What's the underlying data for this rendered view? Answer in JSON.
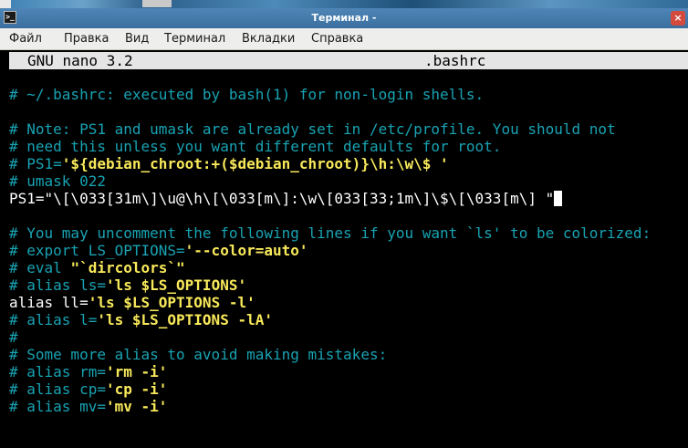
{
  "window": {
    "title": "Терминал -",
    "close_glyph": "×",
    "app_icon_glyph": ">_"
  },
  "menu": [
    "Файл",
    "Правка",
    "Вид",
    "Терминал",
    "Вкладки",
    "Справка"
  ],
  "nano": {
    "version": "GNU nano 3.2",
    "filename": ".bashrc"
  },
  "editor_lines": [
    {
      "blank": false,
      "segs": [
        {
          "t": "# ~/.bashrc: executed by bash(1) for non-login shells.",
          "c": "c"
        }
      ]
    },
    {
      "blank": true,
      "segs": []
    },
    {
      "blank": false,
      "segs": [
        {
          "t": "# Note: PS1 and umask are already set in /etc/profile. You should not",
          "c": "c"
        }
      ]
    },
    {
      "blank": false,
      "segs": [
        {
          "t": "# need this unless you want different defaults for root.",
          "c": "c"
        }
      ]
    },
    {
      "blank": false,
      "segs": [
        {
          "t": "# PS1=",
          "c": "c"
        },
        {
          "t": "'${debian_chroot:+($debian_chroot)}\\h:\\w\\$ '",
          "c": "y"
        }
      ]
    },
    {
      "blank": false,
      "segs": [
        {
          "t": "# umask 022",
          "c": "c"
        }
      ]
    },
    {
      "blank": false,
      "cursor": true,
      "segs": [
        {
          "t": "PS1=",
          "c": "w"
        },
        {
          "t": "\"\\[\\033[31m\\]\\u@\\h\\[\\033[m\\]:\\w\\[033[33;1m\\]\\$\\[\\033[m\\] \"",
          "c": "w"
        }
      ]
    },
    {
      "blank": true,
      "segs": []
    },
    {
      "blank": false,
      "segs": [
        {
          "t": "# You may uncomment the following lines if you want `ls' to be colorized:",
          "c": "c"
        }
      ]
    },
    {
      "blank": false,
      "segs": [
        {
          "t": "# export LS_OPTIONS=",
          "c": "c"
        },
        {
          "t": "'--color=auto'",
          "c": "y"
        }
      ]
    },
    {
      "blank": false,
      "segs": [
        {
          "t": "# eval ",
          "c": "c"
        },
        {
          "t": "\"`dircolors`\"",
          "c": "y"
        }
      ]
    },
    {
      "blank": false,
      "segs": [
        {
          "t": "# alias ls=",
          "c": "c"
        },
        {
          "t": "'ls $LS_OPTIONS'",
          "c": "y"
        }
      ]
    },
    {
      "blank": false,
      "segs": [
        {
          "t": "alias ll=",
          "c": "w"
        },
        {
          "t": "'ls $LS_OPTIONS -l'",
          "c": "y"
        }
      ]
    },
    {
      "blank": false,
      "segs": [
        {
          "t": "# alias l=",
          "c": "c"
        },
        {
          "t": "'ls $LS_OPTIONS -lA'",
          "c": "y"
        }
      ]
    },
    {
      "blank": false,
      "segs": [
        {
          "t": "#",
          "c": "c"
        }
      ]
    },
    {
      "blank": false,
      "segs": [
        {
          "t": "# Some more alias to avoid making mistakes:",
          "c": "c"
        }
      ]
    },
    {
      "blank": false,
      "segs": [
        {
          "t": "# alias rm=",
          "c": "c"
        },
        {
          "t": "'rm -i'",
          "c": "y"
        }
      ]
    },
    {
      "blank": false,
      "segs": [
        {
          "t": "# alias cp=",
          "c": "c"
        },
        {
          "t": "'cp -i'",
          "c": "y"
        }
      ]
    },
    {
      "blank": false,
      "segs": [
        {
          "t": "# alias mv=",
          "c": "c"
        },
        {
          "t": "'mv -i'",
          "c": "y"
        }
      ]
    }
  ],
  "colors": {
    "comment": "#18a3b3",
    "string": "#f8e95a",
    "text": "#ffffff",
    "background": "#000000",
    "titlebar": "#4f86b7"
  }
}
